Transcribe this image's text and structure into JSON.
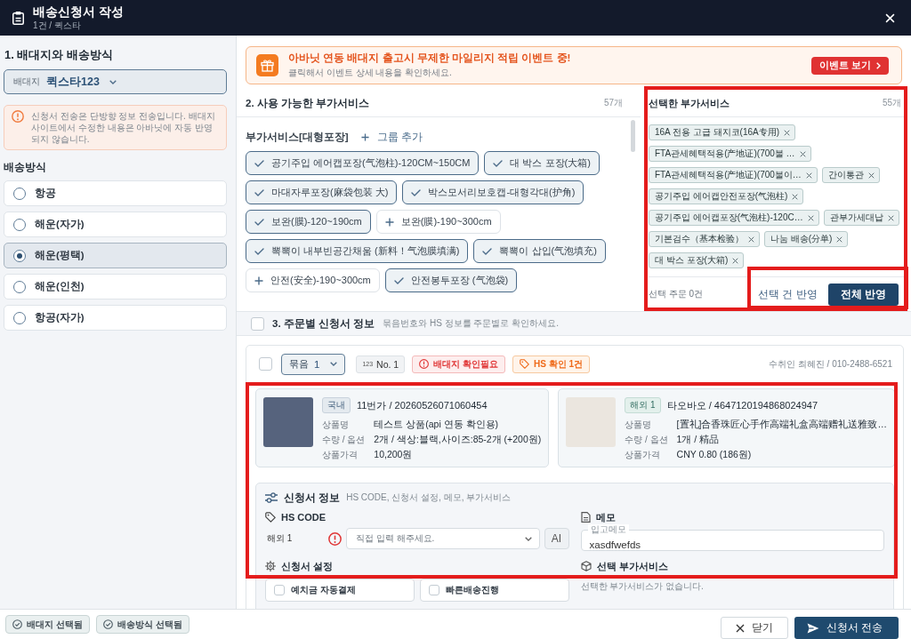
{
  "header": {
    "title": "배송신청서 작성",
    "subtitle": "1건 / 퀵스타"
  },
  "sidebar": {
    "title": "1. 배대지와 배송방식",
    "forwarder": {
      "label": "배대지",
      "value": "퀵스타123"
    },
    "notice": "신청서 전송은 단방향 정보 전송입니다. 배대지 사이트에서 수정한 내용은 아바닛에 자동 반영되지 않습니다.",
    "methods_title": "배송방식",
    "methods": [
      {
        "label": "항공",
        "selected": false
      },
      {
        "label": "해운(자가)",
        "selected": false
      },
      {
        "label": "해운(평택)",
        "selected": true
      },
      {
        "label": "해운(인천)",
        "selected": false
      },
      {
        "label": "항공(자가)",
        "selected": false
      }
    ]
  },
  "banner": {
    "title": "아바닛 연동 배대지 출고시 무제한 마일리지 적립 이벤트 중!",
    "subtitle": "클릭해서 이벤트 상세 내용을 확인하세요.",
    "button": "이벤트 보기"
  },
  "available_services": {
    "title": "2. 사용 가능한 부가서비스",
    "count": "57개",
    "groups": [
      {
        "name": "부가서비스[대형포장]",
        "add_label": "그룹 추가",
        "items": [
          {
            "label": "공기주입 에어캡포장(气泡柱)-120CM~150CM",
            "selected": true
          },
          {
            "label": "대 박스 포장(大箱)",
            "selected": true
          },
          {
            "label": "마대자루포장(麻袋包装 大)",
            "selected": true
          },
          {
            "label": "박스모서리보호캡-대형각대(护角)",
            "selected": true
          },
          {
            "label": "보완(膜)-120~190cm",
            "selected": true
          },
          {
            "label": "보완(膜)-190~300cm",
            "selected": false
          },
          {
            "label": "뽁뽁이 내부빈공간채움 (新料！气泡膜填满)",
            "selected": true
          },
          {
            "label": "뽁뽁이 삽입(气泡填充)",
            "selected": true
          },
          {
            "label": "안전(安全)-190~300cm",
            "selected": false
          },
          {
            "label": "안전봉투포장 (气泡袋)",
            "selected": true
          }
        ]
      }
    ]
  },
  "selected_services": {
    "title": "선택한 부가서비스",
    "count": "55개",
    "highlighted": true,
    "items": [
      "16A 전용 고급 돼지코(16A专用)",
      "FTA관세혜택적용(产地证)(700불 …",
      "FTA관세혜택적용(产地证)(700불이…",
      "간이통관",
      "공기주입 에어캡안전포장(气泡柱)",
      "공기주입 에어캡포장(气泡柱)-120C…",
      "관부가세대납",
      "기본검수（基本检验）",
      "나눔 배송(分单)",
      "대 박스 포장(大箱)"
    ],
    "selection_count": "선택 주문 0건",
    "apply_selected": "선택 건 반영",
    "apply_all": "전체 반영",
    "actions_highlighted": true
  },
  "orders_section": {
    "title": "3. 주문별 신청서 정보",
    "hint": "묶음번호와 HS 정보를 주문별로 확인하세요.",
    "checked": false
  },
  "orders": [
    {
      "checked": false,
      "bundle": {
        "label": "묶음",
        "value": "1"
      },
      "number": {
        "prefix": "123",
        "label": "No. 1"
      },
      "tags": [
        {
          "kind": "error",
          "label": "배대지 확인필요"
        },
        {
          "kind": "warning",
          "label": "HS 확인 1건"
        }
      ],
      "recipient": "수취인 최혜진 / 010-2488-6521",
      "highlighted": true,
      "products": [
        {
          "kind": "domestic",
          "origin": "국내",
          "title": "11번가 / 20260526071060454",
          "fields": [
            {
              "label": "상품명",
              "value": "테스트 상품(api 연동 확인용)"
            },
            {
              "label": "수량 / 옵션",
              "value": "2개 / 색상:블랙,사이즈:85-2개 (+200원)"
            },
            {
              "label": "상품가격",
              "value": "10,200원"
            }
          ]
        },
        {
          "kind": "overseas",
          "origin": "해외 1",
          "title": "타오바오 / 4647120194868024947",
          "fields": [
            {
              "label": "상품명",
              "value": "[置礼]合香珠匠心手作高端礼盒高端赠礼送雅致…"
            },
            {
              "label": "수량 / 옵션",
              "value": "1개 / 精品"
            },
            {
              "label": "상품가격",
              "value": "CNY 0.80 (186원)"
            }
          ]
        }
      ],
      "info": {
        "title": "신청서 정보",
        "hint": "HS CODE, 신청서 설정, 메모, 부가서비스",
        "hs_code": {
          "title": "HS CODE",
          "rows": [
            {
              "label": "해외 1",
              "error": true,
              "placeholder": "직접 입력 해주세요.",
              "ai_button": "AI"
            }
          ]
        },
        "memo": {
          "title": "메모",
          "label": "입고메모",
          "value": "xasdfwefds"
        },
        "settings": {
          "title": "신청서 설정",
          "options": [
            {
              "label": "예치금 자동결제",
              "checked": false
            },
            {
              "label": "빠른배송진행",
              "checked": false
            }
          ]
        },
        "extra_services": {
          "title": "선택 부가서비스",
          "empty_text": "선택한 부가서비스가 없습니다."
        }
      }
    }
  ],
  "footer": {
    "status": [
      "배대지 선택됨",
      "배송방식 선택됨"
    ],
    "close_button": "닫기",
    "submit_button": "신청서 전송"
  }
}
